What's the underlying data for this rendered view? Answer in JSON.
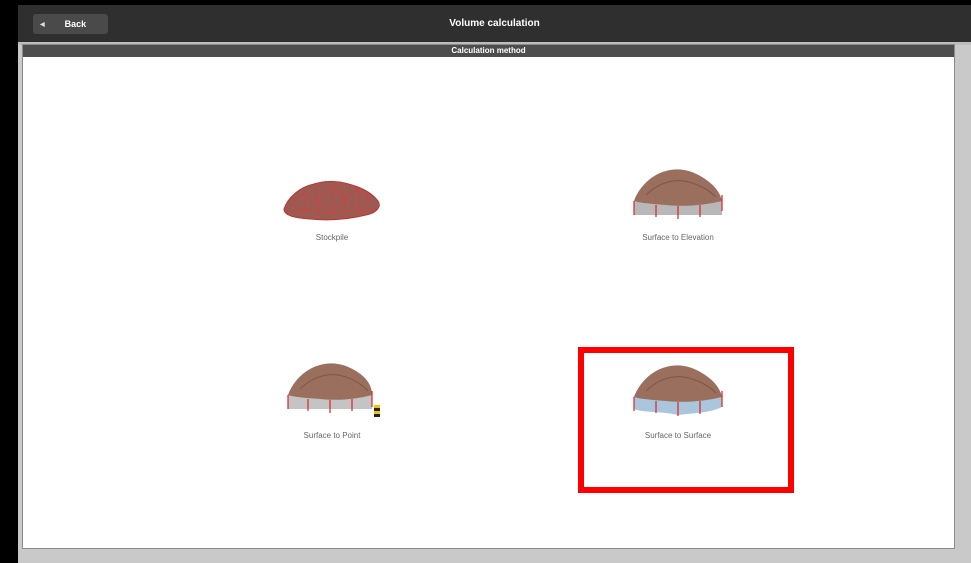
{
  "header": {
    "title": "Volume calculation",
    "back_label": "Back"
  },
  "panel": {
    "title": "Calculation method"
  },
  "options": [
    {
      "label": "Stockpile",
      "icon": "stockpile-mesh-icon"
    },
    {
      "label": "Surface to Elevation",
      "icon": "surface-to-elevation-icon"
    },
    {
      "label": "Surface to Point",
      "icon": "surface-to-point-icon"
    },
    {
      "label": "Surface to Surface",
      "icon": "surface-to-surface-icon"
    }
  ],
  "colors": {
    "header": "#2f2f2f",
    "highlight": "#ff0000",
    "pile": "#9b6f5e",
    "mesh": "#d22"
  }
}
